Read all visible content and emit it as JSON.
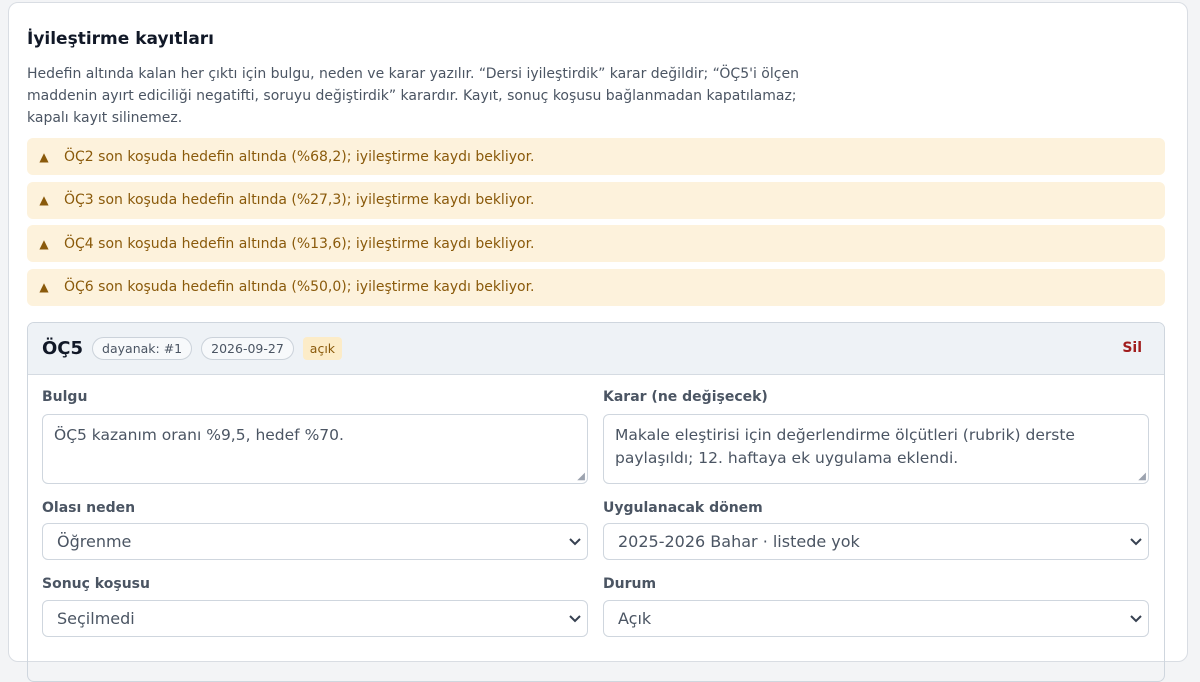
{
  "page": {
    "title": "İyileştirme kayıtları",
    "description": "Hedefin altında kalan her çıktı için bulgu, neden ve karar yazılır. “Dersi iyileştirdik” karar değildir; “ÖÇ5'i ölçen maddenin ayırt ediciliği negatifti, soruyu değiştirdik” karardır. Kayıt, sonuç koşusu bağlanmadan kapatılamaz; kapalı kayıt silinemez."
  },
  "alerts": [
    {
      "icon": "warning-triangle-icon",
      "text": "ÖÇ2 son koşuda hedefin altında (%68,2); iyileştirme kaydı bekliyor."
    },
    {
      "icon": "warning-triangle-icon",
      "text": "ÖÇ3 son koşuda hedefin altında (%27,3); iyileştirme kaydı bekliyor."
    },
    {
      "icon": "warning-triangle-icon",
      "text": "ÖÇ4 son koşuda hedefin altında (%13,6); iyileştirme kaydı bekliyor."
    },
    {
      "icon": "warning-triangle-icon",
      "text": "ÖÇ6 son koşuda hedefin altında (%50,0); iyileştirme kaydı bekliyor."
    }
  ],
  "record": {
    "code": "ÖÇ5",
    "basis": "dayanak: #1",
    "date": "2026-09-27",
    "status": "açık",
    "delete_label": "Sil",
    "fields": {
      "finding_label": "Bulgu",
      "finding_value": "ÖÇ5 kazanım oranı %9,5, hedef %70.",
      "decision_label": "Karar (ne değişecek)",
      "decision_value": "Makale eleştirisi için değerlendirme ölçütleri (rubrik) derste paylaşıldı; 12. haftaya ek uygulama eklendi.",
      "cause_label": "Olası neden",
      "cause_value": "Öğrenme",
      "term_label": "Uygulanacak dönem",
      "term_value": "2025-2026 Bahar · listede yok",
      "run_label": "Sonuç koşusu",
      "run_value": "Seçilmedi",
      "state_label": "Durum",
      "state_value": "Açık"
    }
  },
  "colors": {
    "alert_bg": "#fdf2dc",
    "alert_text": "#8a5a0b",
    "delete_text": "#a11d1d",
    "header_bg": "#eef2f6"
  }
}
